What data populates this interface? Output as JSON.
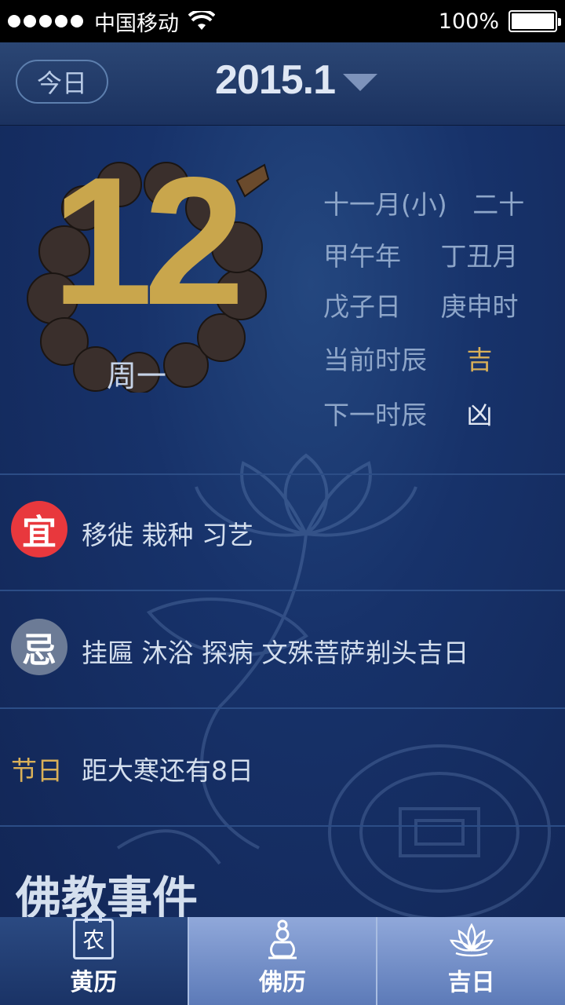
{
  "status_bar": {
    "carrier": "中国移动",
    "battery": "100%"
  },
  "header": {
    "today_label": "今日",
    "month_title": "2015.1"
  },
  "day": {
    "number": "12",
    "weekday": "周一"
  },
  "lunar": {
    "lunar_month": "十一月(小)",
    "lunar_day": "二十",
    "year_ganzhi": "甲午年",
    "month_ganzhi": "丁丑月",
    "day_ganzhi": "戊子日",
    "hour_ganzhi": "庚申时",
    "current_hour_label": "当前时辰",
    "current_hour_value": "吉",
    "next_hour_label": "下一时辰",
    "next_hour_value": "凶"
  },
  "yi": {
    "badge": "宜",
    "items": "移徙  栽种  习艺"
  },
  "ji": {
    "badge": "忌",
    "items": "挂匾  沐浴  探病  文殊菩萨剃头吉日"
  },
  "festival": {
    "label": "节日",
    "text": "距大寒还有8日"
  },
  "events": {
    "title": "佛教事件"
  },
  "tabs": [
    {
      "label": "黄历",
      "icon_text": "农"
    },
    {
      "label": "佛历"
    },
    {
      "label": "吉日"
    }
  ],
  "colors": {
    "accent_gold": "#c9a64c",
    "yi_red": "#e8383d",
    "ji_gray": "#6c7b96"
  }
}
